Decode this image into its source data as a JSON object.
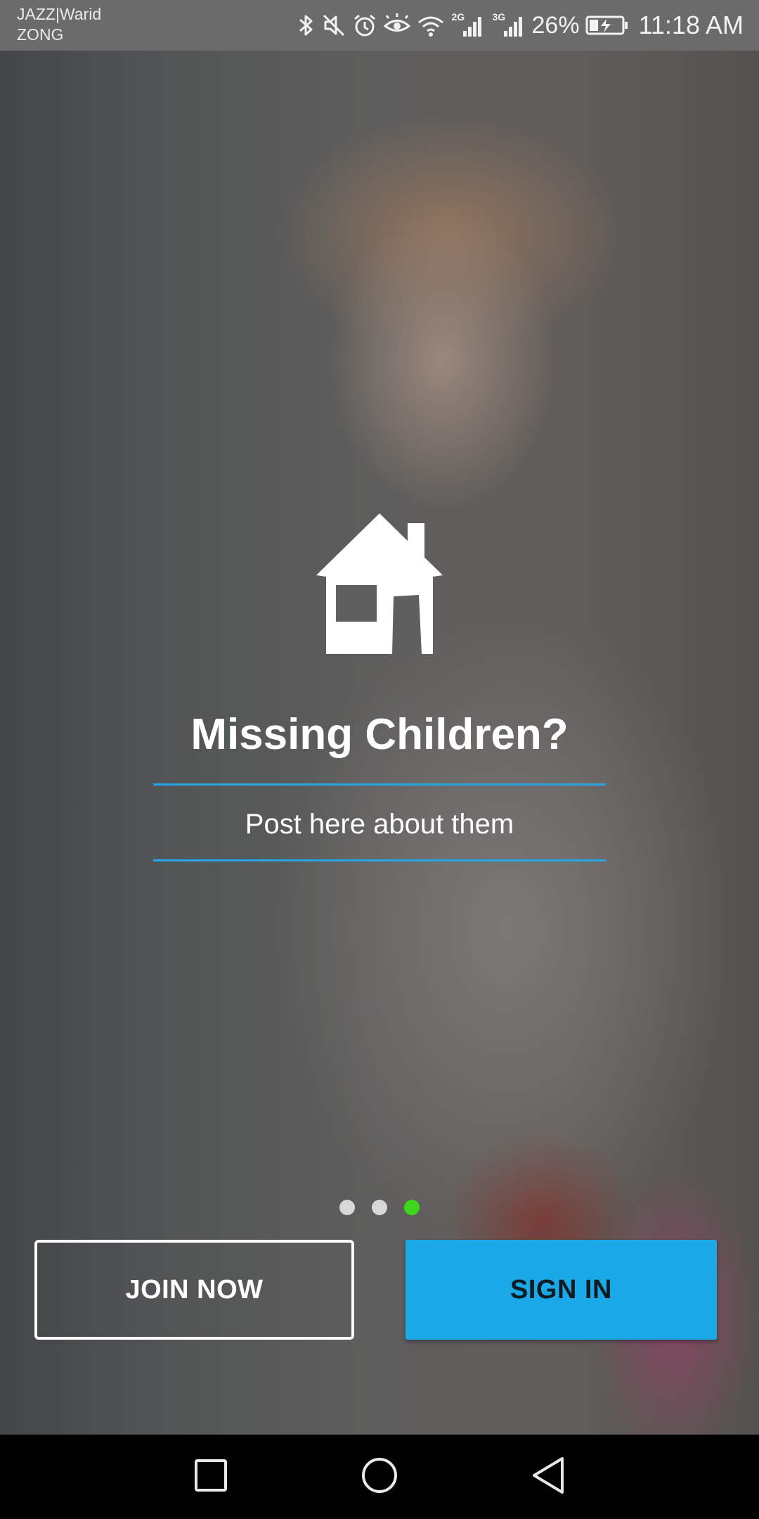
{
  "status_bar": {
    "carrier_line1": "JAZZ|Warid",
    "carrier_line2": "ZONG",
    "sim1_network": "2G",
    "sim2_network": "3G",
    "battery_percent": "26%",
    "time": "11:18 AM"
  },
  "onboarding": {
    "icon": "house-icon",
    "headline": "Missing Children?",
    "subline": "Post here about them",
    "page_count": 3,
    "active_page": 3
  },
  "actions": {
    "join_label": "JOIN NOW",
    "signin_label": "SIGN IN"
  },
  "colors": {
    "accent_blue": "#1aa9e6",
    "divider_blue": "#26a6e4",
    "active_dot": "#3cd61a",
    "inactive_dot": "#d8d8d8"
  },
  "nav_bar": {
    "icons": [
      "recent-apps-icon",
      "home-icon",
      "back-icon"
    ]
  }
}
